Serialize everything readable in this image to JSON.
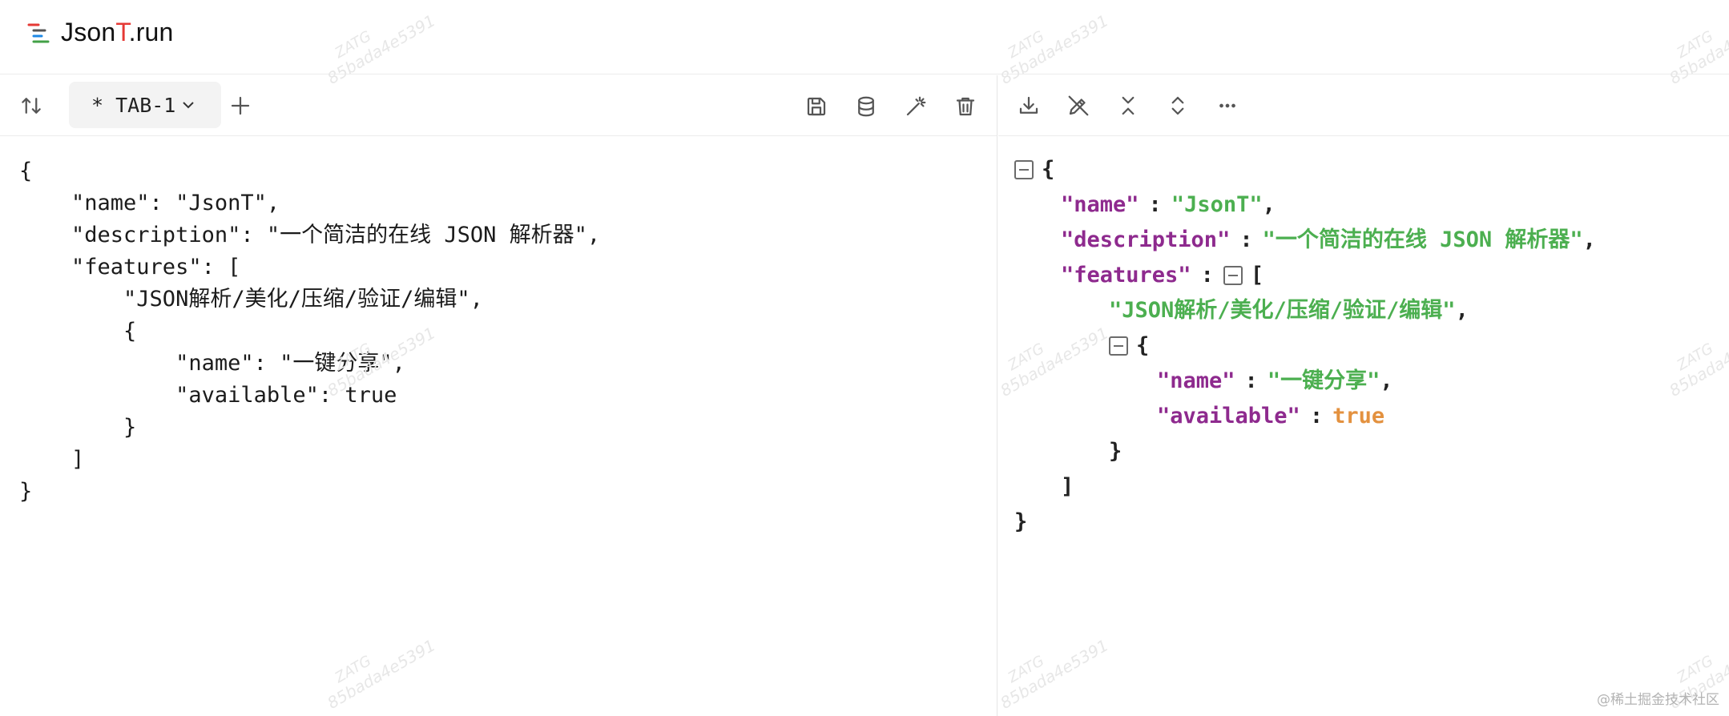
{
  "header": {
    "logo_icon": "menu-lines-logo-icon",
    "brand_prefix": "Json",
    "brand_accent": "T",
    "brand_suffix": ".run",
    "accent_color": "#e53935"
  },
  "left_toolbar": {
    "swap_icon": "swap-vertical-icon",
    "tab_label": "* TAB-1",
    "tab_chevron_icon": "chevron-down-icon",
    "add_tab_icon": "plus-icon",
    "actions": [
      {
        "icon": "save-icon"
      },
      {
        "icon": "database-icon"
      },
      {
        "icon": "magic-wand-icon"
      },
      {
        "icon": "trash-icon"
      }
    ]
  },
  "editor": {
    "lines": [
      "{",
      "    \"name\": \"JsonT\",",
      "    \"description\": \"一个简洁的在线 JSON 解析器\",",
      "    \"features\": [",
      "        \"JSON解析/美化/压缩/验证/编辑\",",
      "        {",
      "            \"name\": \"一键分享\",",
      "            \"available\": true",
      "        }",
      "    ]",
      "}"
    ]
  },
  "right_toolbar": {
    "actions": [
      {
        "icon": "download-icon"
      },
      {
        "icon": "edit-off-icon"
      },
      {
        "icon": "collapse-all-icon"
      },
      {
        "icon": "expand-all-icon"
      },
      {
        "icon": "more-horizontal-icon"
      }
    ]
  },
  "tree": {
    "open_brace": "{",
    "close_brace": "}",
    "name_key": "\"name\"",
    "name_value": "\"JsonT\"",
    "description_key": "\"description\"",
    "description_value": "\"一个简洁的在线 JSON 解析器\"",
    "features_key": "\"features\"",
    "open_bracket": "[",
    "close_bracket": "]",
    "feature_item_1": "\"JSON解析/美化/压缩/验证/编辑\"",
    "nested_name_key": "\"name\"",
    "nested_name_value": "\"一键分享\"",
    "available_key": "\"available\"",
    "available_value": "true",
    "colon": ":",
    "comma": ",",
    "colors": {
      "key": "#8e2a8e",
      "string": "#4caf50",
      "boolean": "#e3913f"
    }
  },
  "watermark": {
    "line1": "ZATG",
    "line2": "85bada4e5391"
  },
  "credit": "@稀土掘金技术社区"
}
